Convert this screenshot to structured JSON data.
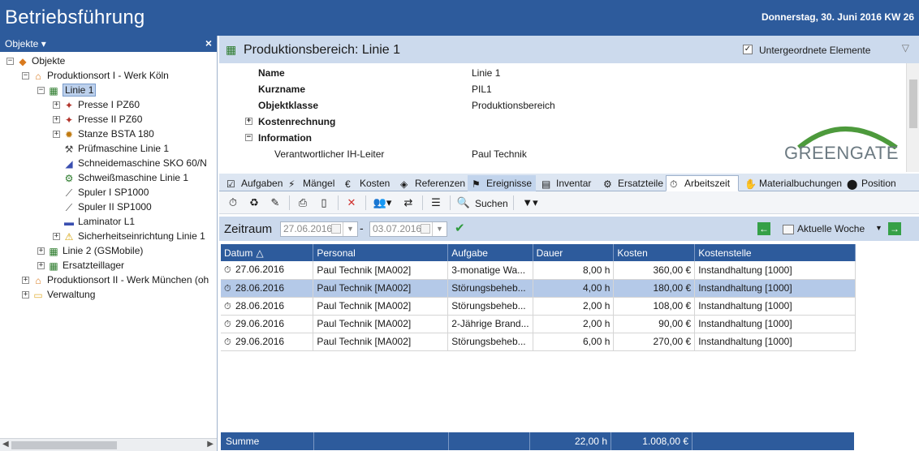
{
  "app": {
    "title": "Betriebsführung",
    "date_label": "Donnerstag, 30. Juni 2016  KW 26"
  },
  "left_panel": {
    "header": "Objekte ▾",
    "close": "×",
    "tree": [
      {
        "label": "Objekte",
        "level": 0,
        "expanded": true,
        "icon": "objects-icon"
      },
      {
        "label": "Produktionsort I - Werk Köln",
        "level": 1,
        "expanded": true,
        "icon": "site-icon"
      },
      {
        "label": "Linie 1",
        "level": 2,
        "expanded": true,
        "icon": "production-line-icon",
        "selected": true
      },
      {
        "label": "Presse I PZ60",
        "level": 3,
        "expanded": false,
        "icon": "press-icon"
      },
      {
        "label": "Presse II PZ60",
        "level": 3,
        "expanded": false,
        "icon": "press-icon"
      },
      {
        "label": "Stanze BSTA 180",
        "level": 3,
        "expanded": false,
        "icon": "punch-icon"
      },
      {
        "label": "Prüfmaschine Linie 1",
        "level": 3,
        "icon": "test-machine-icon"
      },
      {
        "label": "Schneidemaschine SKO 60/N",
        "level": 3,
        "icon": "cutter-icon"
      },
      {
        "label": "Schweißmaschine Linie 1",
        "level": 3,
        "icon": "welder-icon"
      },
      {
        "label": "Spuler I SP1000",
        "level": 3,
        "icon": "spooler-icon"
      },
      {
        "label": "Spuler II SP1000",
        "level": 3,
        "icon": "spooler-icon"
      },
      {
        "label": "Laminator L1",
        "level": 3,
        "icon": "laminator-icon"
      },
      {
        "label": "Sicherheitseinrichtung Linie 1",
        "level": 3,
        "expanded": false,
        "icon": "warning-icon"
      },
      {
        "label": "Linie 2 (GSMobile)",
        "level": 2,
        "expanded": false,
        "icon": "production-line-icon"
      },
      {
        "label": "Ersatzteillager",
        "level": 2,
        "expanded": false,
        "icon": "warehouse-icon"
      },
      {
        "label": "Produktionsort II - Werk München (oh",
        "level": 1,
        "expanded": false,
        "icon": "site-icon"
      },
      {
        "label": "Verwaltung",
        "level": 1,
        "expanded": false,
        "icon": "folder-icon"
      }
    ]
  },
  "detail": {
    "title": "Produktionsbereich: Linie 1",
    "subitems_label": "Untergeordnete Elemente",
    "subitems_checked": true,
    "properties": [
      {
        "key": "Name",
        "value": "Linie 1"
      },
      {
        "key": "Kurzname",
        "value": "PIL1"
      },
      {
        "key": "Objektklasse",
        "value": "Produktionsbereich"
      },
      {
        "key": "Kostenrechnung",
        "value": "",
        "group": true,
        "expanded": false
      },
      {
        "key": "Information",
        "value": "",
        "group": true,
        "expanded": true
      },
      {
        "key": "Verantwortlicher IH-Leiter",
        "value": "Paul Technik",
        "sub": true
      }
    ],
    "logo_text": "GREENGATE"
  },
  "tabs": [
    {
      "label": "Aufgaben",
      "icon": "task-icon"
    },
    {
      "label": "Mängel",
      "icon": "defect-icon"
    },
    {
      "label": "Kosten",
      "icon": "cost-icon"
    },
    {
      "label": "Referenzen",
      "icon": "reference-icon"
    },
    {
      "label": "Ereignisse",
      "icon": "event-icon",
      "hot": true
    },
    {
      "label": "Inventar",
      "icon": "inventory-icon"
    },
    {
      "label": "Ersatzteile",
      "icon": "spare-parts-icon"
    },
    {
      "label": "Arbeitszeit",
      "icon": "worktime-icon",
      "active": true
    },
    {
      "label": "Materialbuchungen",
      "icon": "material-icon"
    },
    {
      "label": "Position",
      "icon": "position-icon"
    }
  ],
  "toolbar": {
    "search_label": "Suchen"
  },
  "period": {
    "label": "Zeitraum",
    "from": "27.06.2016",
    "to": "03.07.2016",
    "dash": "-",
    "week_label": "Aktuelle Woche"
  },
  "grid": {
    "columns": [
      "Datum",
      "Personal",
      "Aufgabe",
      "Dauer",
      "Kosten",
      "Kostenstelle"
    ],
    "sort_indicator": "△",
    "rows": [
      {
        "datum": "27.06.2016",
        "personal": "Paul Technik [MA002]",
        "aufgabe": "3-monatige Wa...",
        "dauer": "8,00 h",
        "kosten": "360,00 €",
        "kostenstelle": "Instandhaltung [1000]"
      },
      {
        "datum": "28.06.2016",
        "personal": "Paul Technik [MA002]",
        "aufgabe": "Störungsbeheb...",
        "dauer": "4,00 h",
        "kosten": "180,00 €",
        "kostenstelle": "Instandhaltung [1000]",
        "selected": true
      },
      {
        "datum": "28.06.2016",
        "personal": "Paul Technik [MA002]",
        "aufgabe": "Störungsbeheb...",
        "dauer": "2,00 h",
        "kosten": "108,00 €",
        "kostenstelle": "Instandhaltung [1000]"
      },
      {
        "datum": "29.06.2016",
        "personal": "Paul Technik [MA002]",
        "aufgabe": "2-Jährige Brand...",
        "dauer": "2,00 h",
        "kosten": "90,00 €",
        "kostenstelle": "Instandhaltung [1000]"
      },
      {
        "datum": "29.06.2016",
        "personal": "Paul Technik [MA002]",
        "aufgabe": "Störungsbeheb...",
        "dauer": "6,00 h",
        "kosten": "270,00 €",
        "kostenstelle": "Instandhaltung [1000]"
      }
    ],
    "summary": {
      "label": "Summe",
      "dauer": "22,00 h",
      "kosten": "1.008,00 €"
    }
  },
  "colors": {
    "accent": "#2d5b9c",
    "header_light": "#ccdaed",
    "selection": "#b4c9e8",
    "green": "#35a047"
  }
}
